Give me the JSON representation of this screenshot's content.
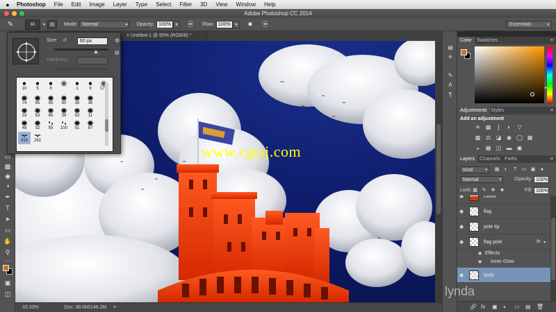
{
  "menubar": {
    "app": "Photoshop",
    "items": [
      "File",
      "Edit",
      "Image",
      "Layer",
      "Type",
      "Select",
      "Filter",
      "3D",
      "View",
      "Window",
      "Help"
    ]
  },
  "window": {
    "title": "Adobe Photoshop CC 2014"
  },
  "options_bar": {
    "brush_size": "60",
    "mode_label": "Mode:",
    "mode_value": "Normal",
    "opacity_label": "Opacity:",
    "opacity_value": "100%",
    "flow_label": "Flow:",
    "flow_value": "100%",
    "workspace": "Essentials"
  },
  "document": {
    "tab_title": "Untitled-1 @ 50% (RGB/8) *",
    "tab_close": "×",
    "zoom": "33.33%",
    "doc_info": "Doc: 38.0M/148.2M",
    "watermark": "www.cgtsj.com"
  },
  "brush_picker": {
    "size_label": "Size:",
    "size_value": "60 px",
    "hardness_label": "Hardness:",
    "brushes": [
      {
        "n": "10",
        "kind": "round"
      },
      {
        "n": "5",
        "kind": "round"
      },
      {
        "n": "8",
        "kind": "round"
      },
      {
        "n": "",
        "kind": "soft"
      },
      {
        "n": "1",
        "kind": "round"
      },
      {
        "n": "9",
        "kind": "round"
      },
      {
        "n": "175",
        "kind": "soft"
      },
      {
        "n": "74",
        "kind": "leaf"
      },
      {
        "n": "95",
        "kind": "splat"
      },
      {
        "n": "95",
        "kind": "splat"
      },
      {
        "n": "90",
        "kind": "splat"
      },
      {
        "n": "36",
        "kind": "grass"
      },
      {
        "n": "36",
        "kind": "grass"
      },
      {
        "n": "33",
        "kind": "splat"
      },
      {
        "n": "63",
        "kind": "splat"
      },
      {
        "n": "66",
        "kind": "star"
      },
      {
        "n": "39",
        "kind": "splat"
      },
      {
        "n": "63",
        "kind": "splat"
      },
      {
        "n": "11",
        "kind": "splat"
      },
      {
        "n": "48",
        "kind": "leaf"
      },
      {
        "n": "32",
        "kind": "leaf"
      },
      {
        "n": "55",
        "kind": "dots"
      },
      {
        "n": "100",
        "kind": "dots"
      },
      {
        "n": "51",
        "kind": "splat"
      },
      {
        "n": "87",
        "kind": "splat"
      },
      {
        "n": "315",
        "kind": "bird",
        "selected": true
      },
      {
        "n": "292",
        "kind": "bird"
      }
    ]
  },
  "panels": {
    "color_tabs": [
      "Color",
      "Swatches"
    ],
    "adjustment_tabs": [
      "Adjustments",
      "Styles"
    ],
    "adjustment_title": "Add an adjustment",
    "layer_tabs": [
      "Layers",
      "Channels",
      "Paths"
    ],
    "kind": "Kind",
    "blend_mode": "Normal",
    "opacity_label": "Opacity:",
    "opacity_value": "100%",
    "lock_label": "Lock:",
    "fill_label": "Fill:",
    "fill_value": "100%"
  },
  "layers": [
    {
      "name": "castle",
      "kind": "castle"
    },
    {
      "name": "flag",
      "kind": "plain"
    },
    {
      "name": "pole tip",
      "kind": "plain"
    },
    {
      "name": "flag pole",
      "kind": "plain",
      "fx": "fx"
    },
    {
      "name": "birds",
      "kind": "plain",
      "selected": true
    }
  ],
  "layer_effects": {
    "group": "Effects",
    "item": "Inner Glow"
  },
  "brand": "lynda",
  "colors": {
    "foreground": "#c07a1d",
    "background": "#000000",
    "selection": "#7893b8"
  }
}
